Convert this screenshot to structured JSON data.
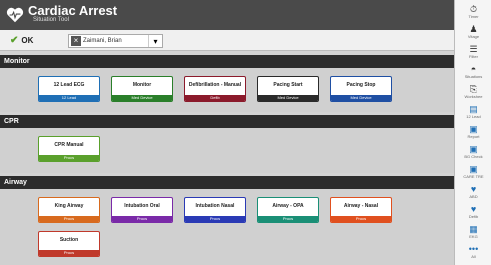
{
  "header": {
    "title": "Cardiac Arrest",
    "subtitle": "Situation Tool"
  },
  "actionbar": {
    "ok_label": "OK",
    "user_name": "Zaimani, Brian"
  },
  "sections": {
    "monitor": {
      "label": "Monitor",
      "cards": [
        {
          "label": "12 Lead ECG",
          "tag": "12 Lead",
          "color": "#1f6fb5"
        },
        {
          "label": "Monitor",
          "tag": "Med Device",
          "color": "#2a7f2a"
        },
        {
          "label": "Defibrillation - Manual",
          "tag": "Defib",
          "color": "#8b1a2b"
        },
        {
          "label": "Pacing Start",
          "tag": "Med Device",
          "color": "#2a2a2a"
        },
        {
          "label": "Pacing Stop",
          "tag": "Med Device",
          "color": "#1f4fa3"
        }
      ]
    },
    "cpr": {
      "label": "CPR",
      "cards": [
        {
          "label": "CPR Manual",
          "tag": "Procs",
          "color": "#5aa02c"
        }
      ]
    },
    "airway": {
      "label": "Airway",
      "cards": [
        {
          "label": "King Airway",
          "tag": "Procs",
          "color": "#d86a1e"
        },
        {
          "label": "Intubation Oral",
          "tag": "Procs",
          "color": "#7a2aa8"
        },
        {
          "label": "Intubation Nasal",
          "tag": "Procs",
          "color": "#2a3ab5"
        },
        {
          "label": "Airway - OPA",
          "tag": "Procs",
          "color": "#1a8f76"
        },
        {
          "label": "Airway - Nasal",
          "tag": "Procs",
          "color": "#e0501f"
        },
        {
          "label": "Suction",
          "tag": "Procs",
          "color": "#c0392b"
        }
      ]
    }
  },
  "sidebar": [
    {
      "label": "Timer",
      "icon": "clock-icon",
      "glyph": "⏱"
    },
    {
      "label": "Vitage",
      "icon": "figure-icon",
      "glyph": "♟"
    },
    {
      "label": "Filter",
      "icon": "filter-icon",
      "glyph": "☰"
    },
    {
      "label": "Situations",
      "icon": "situation-icon",
      "glyph": "◓"
    },
    {
      "label": "Workshee",
      "icon": "worksheet-icon",
      "glyph": "⎘"
    },
    {
      "label": "12 Lead",
      "icon": "ecg-icon",
      "glyph": "▤",
      "blue": true
    },
    {
      "label": "Report",
      "icon": "report-icon",
      "glyph": "▣",
      "blue": true
    },
    {
      "label": "BG Check",
      "icon": "bg-icon",
      "glyph": "▣",
      "blue": true
    },
    {
      "label": "CARE TRE",
      "icon": "care-icon",
      "glyph": "▣",
      "blue": true
    },
    {
      "label": "ABD",
      "icon": "heart-icon",
      "glyph": "♥",
      "blue": true
    },
    {
      "label": "Defib",
      "icon": "defib-icon",
      "glyph": "♥",
      "blue": true
    },
    {
      "label": "EKG",
      "icon": "ekg-icon",
      "glyph": "▦",
      "blue": true
    },
    {
      "label": "All",
      "icon": "more-icon",
      "glyph": "•••",
      "blue": true
    }
  ]
}
